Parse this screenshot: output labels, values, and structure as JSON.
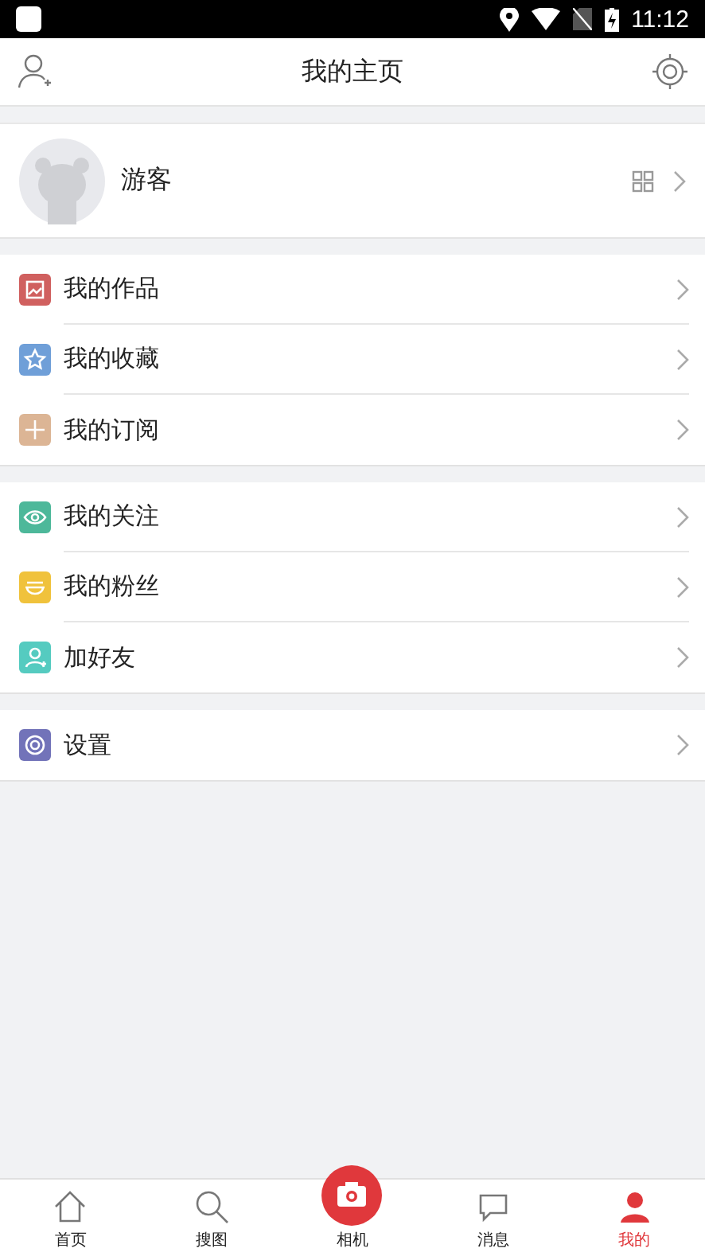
{
  "status_bar": {
    "time": "11:12"
  },
  "header": {
    "title": "我的主页"
  },
  "profile": {
    "name": "游客"
  },
  "sections": [
    {
      "items": [
        {
          "label": "我的作品",
          "kind": "picture",
          "color": "#d0605f"
        },
        {
          "label": "我的收藏",
          "kind": "star",
          "color": "#6f9fd8"
        },
        {
          "label": "我的订阅",
          "kind": "plus",
          "color": "#dcb595"
        }
      ]
    },
    {
      "items": [
        {
          "label": "我的关注",
          "kind": "eye",
          "color": "#4db89a"
        },
        {
          "label": "我的粉丝",
          "kind": "bowl",
          "color": "#f0c23c"
        },
        {
          "label": "加好友",
          "kind": "person",
          "color": "#55cbc0"
        }
      ]
    },
    {
      "items": [
        {
          "label": "设置",
          "kind": "gear",
          "color": "#7273b9"
        }
      ]
    }
  ],
  "tabs": [
    {
      "label": "首页",
      "kind": "home",
      "selected": false
    },
    {
      "label": "搜图",
      "kind": "search",
      "selected": false
    },
    {
      "label": "相机",
      "kind": "camera",
      "selected": false
    },
    {
      "label": "消息",
      "kind": "chat",
      "selected": false
    },
    {
      "label": "我的",
      "kind": "me",
      "selected": true
    }
  ]
}
